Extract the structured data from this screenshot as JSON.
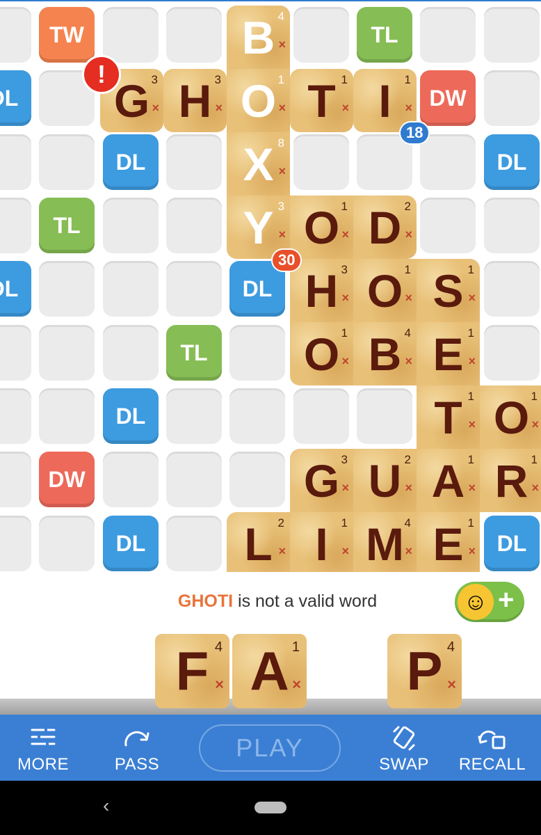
{
  "board": {
    "bonus_squares": [
      {
        "name": "tw",
        "label": "TW",
        "type": "tw"
      },
      {
        "name": "tl",
        "label": "TL",
        "type": "tl"
      },
      {
        "name": "dl",
        "label": "DL",
        "type": "dl"
      },
      {
        "name": "dw",
        "label": "DW",
        "type": "dw"
      }
    ],
    "played_word_boxy": {
      "letters": [
        "B",
        "O",
        "X",
        "Y"
      ],
      "points": [
        "4",
        "1",
        "8",
        "3"
      ]
    },
    "placed_tiles": [
      {
        "letter": "G",
        "points": "3"
      },
      {
        "letter": "H",
        "points": "3"
      },
      {
        "letter": "T",
        "points": "1"
      },
      {
        "letter": "I",
        "points": "1"
      }
    ],
    "existing_words": {
      "od": {
        "letters": [
          "O",
          "D"
        ],
        "points": [
          "1",
          "2"
        ]
      },
      "hos": {
        "letters": [
          "H",
          "O",
          "S"
        ],
        "points": [
          "3",
          "1",
          "1"
        ]
      },
      "obe": {
        "letters": [
          "O",
          "B",
          "E"
        ],
        "points": [
          "1",
          "4",
          "1"
        ]
      },
      "to": {
        "letters": [
          "T",
          "O"
        ],
        "points": [
          "1",
          "1"
        ]
      },
      "guar": {
        "letters": [
          "G",
          "U",
          "A",
          "R"
        ],
        "points": [
          "3",
          "2",
          "1",
          "1"
        ]
      },
      "lime": {
        "letters": [
          "L",
          "I",
          "M",
          "E"
        ],
        "points": [
          "2",
          "1",
          "4",
          "1"
        ]
      }
    },
    "score_badges": {
      "current": "18",
      "previous": "30"
    },
    "warning_icon": "exclamation-icon",
    "colors": {
      "dl": "#3d9be0",
      "tl": "#86bd55",
      "dw": "#ed6a5a",
      "tw": "#f5834f",
      "badge": "#2f7bd0",
      "warning": "#e52d22"
    }
  },
  "status": {
    "invalid_word": "GHOTI",
    "message": " is not a valid word"
  },
  "rack": [
    {
      "letter": "F",
      "points": "4"
    },
    {
      "letter": "A",
      "points": "1"
    },
    {
      "letter": "P",
      "points": "4"
    }
  ],
  "toolbar": {
    "more": "MORE",
    "pass": "PASS",
    "play": "PLAY",
    "swap": "SWAP",
    "recall": "RECALL",
    "icons": {
      "more": "menu-lines-icon",
      "pass": "pass-arrow-icon",
      "swap": "swap-tiles-icon",
      "recall": "recall-tiles-icon"
    }
  },
  "system_nav": {
    "icons": [
      "back-icon",
      "home-icon"
    ]
  }
}
